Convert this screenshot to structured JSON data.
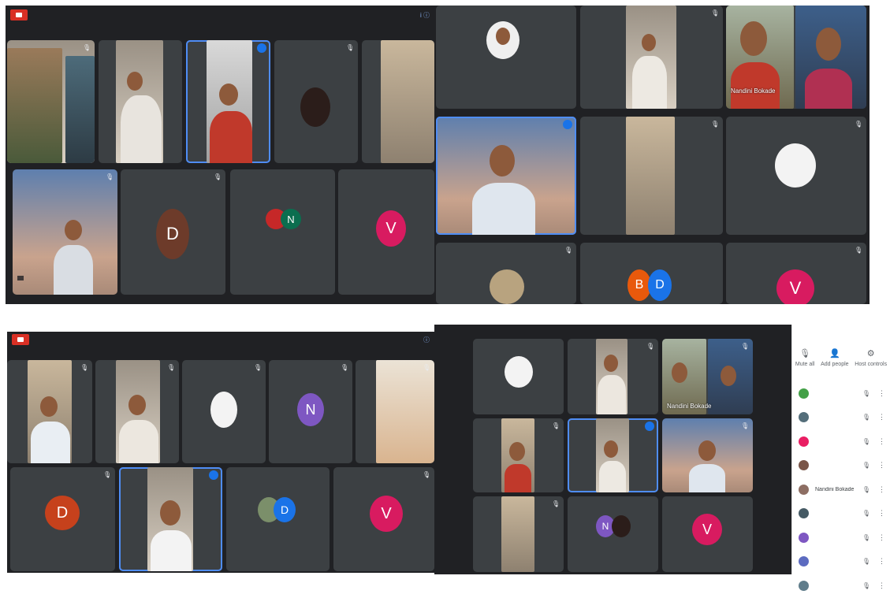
{
  "panel1": {
    "title": "",
    "tiles": [
      {
        "name": ""
      },
      {
        "name": ""
      },
      {
        "name": ""
      },
      {
        "name": ""
      },
      {
        "name": ""
      },
      {
        "name": ""
      },
      {
        "name": "",
        "avatar_letter": "D",
        "avatar_color": "#6d3b2a"
      },
      {
        "name": "",
        "avatar_letter": "N",
        "avatar_color": "#0b6e4f"
      },
      {
        "name": "",
        "avatar_letter": "V",
        "avatar_color": "#d81b60"
      }
    ]
  },
  "panel2": {
    "tiles": [
      {
        "name": ""
      },
      {
        "name": ""
      },
      {
        "name": "Nandini Bokade"
      },
      {
        "name": ""
      },
      {
        "name": ""
      },
      {
        "name": ""
      },
      {
        "name": ""
      },
      {
        "name": "",
        "avatar_letters": [
          "B",
          "D"
        ],
        "avatar_colors": [
          "#e8590c",
          "#1a73e8"
        ]
      },
      {
        "name": "",
        "avatar_letter": "V",
        "avatar_color": "#d81b60"
      }
    ]
  },
  "panel3": {
    "title": "",
    "tiles": [
      {
        "name": ""
      },
      {
        "name": ""
      },
      {
        "name": ""
      },
      {
        "name": "",
        "avatar_letter": "N",
        "avatar_color": "#7e57c2"
      },
      {
        "name": ""
      },
      {
        "name": "",
        "avatar_letter": "D",
        "avatar_color": "#c6411c"
      },
      {
        "name": ""
      },
      {
        "name": "",
        "avatar_letter": "D",
        "avatar_color": "#1a73e8"
      },
      {
        "name": "",
        "avatar_letter": "V",
        "avatar_color": "#d81b60"
      }
    ]
  },
  "panel4": {
    "tiles": [
      {
        "name": ""
      },
      {
        "name": ""
      },
      {
        "name": "Nandini Bokade"
      },
      {
        "name": ""
      },
      {
        "name": ""
      },
      {
        "name": ""
      },
      {
        "name": ""
      },
      {
        "name": "",
        "avatar_letter": "N",
        "avatar_color": "#7e57c2"
      },
      {
        "name": "",
        "avatar_letter": "V",
        "avatar_color": "#d81b60"
      }
    ],
    "sidebar": {
      "actions": [
        {
          "label": "Mute all",
          "icon": "mic-icon"
        },
        {
          "label": "Add people",
          "icon": "add-person-icon"
        },
        {
          "label": "Host controls",
          "icon": "settings-icon"
        }
      ],
      "people": [
        {
          "name": "",
          "color": "#43a047"
        },
        {
          "name": "",
          "color": "#546e7a"
        },
        {
          "name": "",
          "color": "#e91e63"
        },
        {
          "name": "",
          "color": "#795548"
        },
        {
          "name": "Nandini Bokade",
          "color": "#8d6e63"
        },
        {
          "name": "",
          "color": "#455a64"
        },
        {
          "name": "",
          "color": "#7e57c2"
        },
        {
          "name": "",
          "color": "#5c6bc0"
        },
        {
          "name": "",
          "color": "#607d8b"
        }
      ]
    }
  }
}
